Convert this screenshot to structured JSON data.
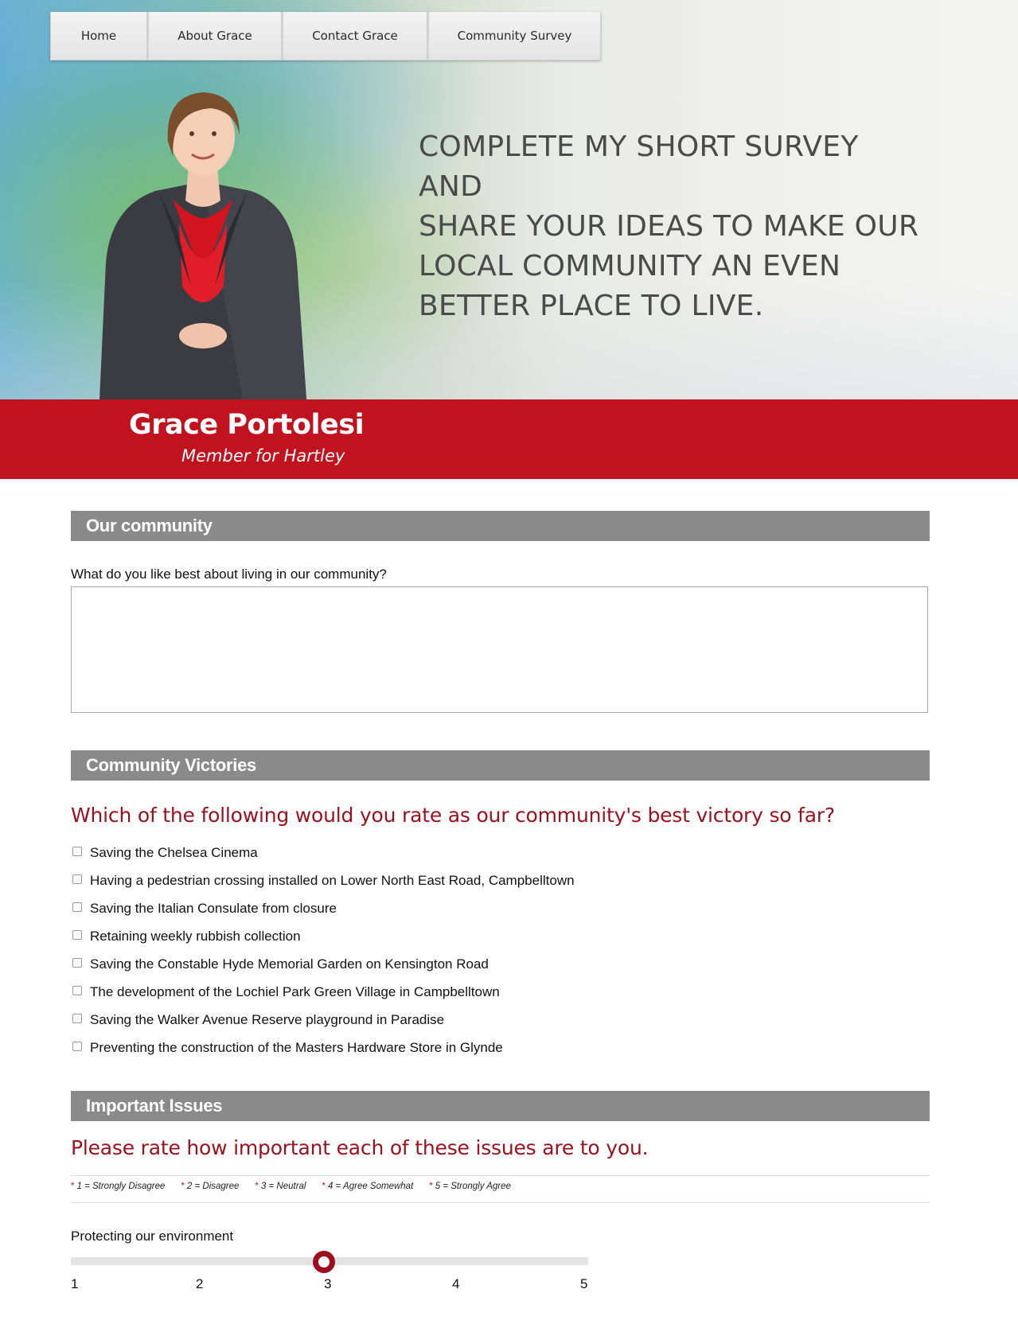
{
  "nav": {
    "items": [
      {
        "label": "Home"
      },
      {
        "label": "About Grace"
      },
      {
        "label": "Contact Grace"
      },
      {
        "label": "Community Survey"
      }
    ]
  },
  "hero": {
    "tagline_lines": [
      "Complete my short survey and",
      "share your ideas to make our",
      "local community an even",
      "better place to live."
    ]
  },
  "banner": {
    "name": "Grace Portolesi",
    "role": "Member for Hartley",
    "color": "#c1121f"
  },
  "sections": {
    "community": {
      "header": "Our community",
      "question": "What do you like best about living in our community?",
      "answer_value": ""
    },
    "victories": {
      "header": "Community Victories",
      "question": "Which of the following would you rate as our community's best victory so far?",
      "options": [
        {
          "label": "Saving the Chelsea Cinema",
          "checked": false
        },
        {
          "label": "Having a pedestrian crossing installed on Lower North East Road, Campbelltown",
          "checked": false
        },
        {
          "label": "Saving the Italian Consulate from closure",
          "checked": false
        },
        {
          "label": "Retaining weekly rubbish collection",
          "checked": false
        },
        {
          "label": "Saving the Constable Hyde Memorial Garden on Kensington Road",
          "checked": false
        },
        {
          "label": "The development of the Lochiel Park Green Village in Campbelltown",
          "checked": false
        },
        {
          "label": "Saving the Walker Avenue Reserve playground in Paradise",
          "checked": false
        },
        {
          "label": "Preventing the construction of the Masters Hardware Store in Glynde",
          "checked": false
        }
      ]
    },
    "issues": {
      "header": "Important Issues",
      "question": "Please rate how important each of these issues are to you.",
      "legend": [
        {
          "star": "*",
          "text": "1 = Strongly Disagree"
        },
        {
          "star": "*",
          "text": "2 = Disagree"
        },
        {
          "star": "*",
          "text": "3 = Neutral"
        },
        {
          "star": "*",
          "text": "4 = Agree Somewhat"
        },
        {
          "star": "*",
          "text": "5 = Strongly Agree"
        }
      ],
      "items": [
        {
          "label": "Protecting our environment",
          "min": 1,
          "max": 5,
          "value": 3,
          "ticks": [
            "1",
            "2",
            "3",
            "4",
            "5"
          ]
        }
      ]
    }
  },
  "colors": {
    "accent_red": "#9c0f1d",
    "banner_red": "#c1121f",
    "section_gray": "#8a8a8a"
  }
}
